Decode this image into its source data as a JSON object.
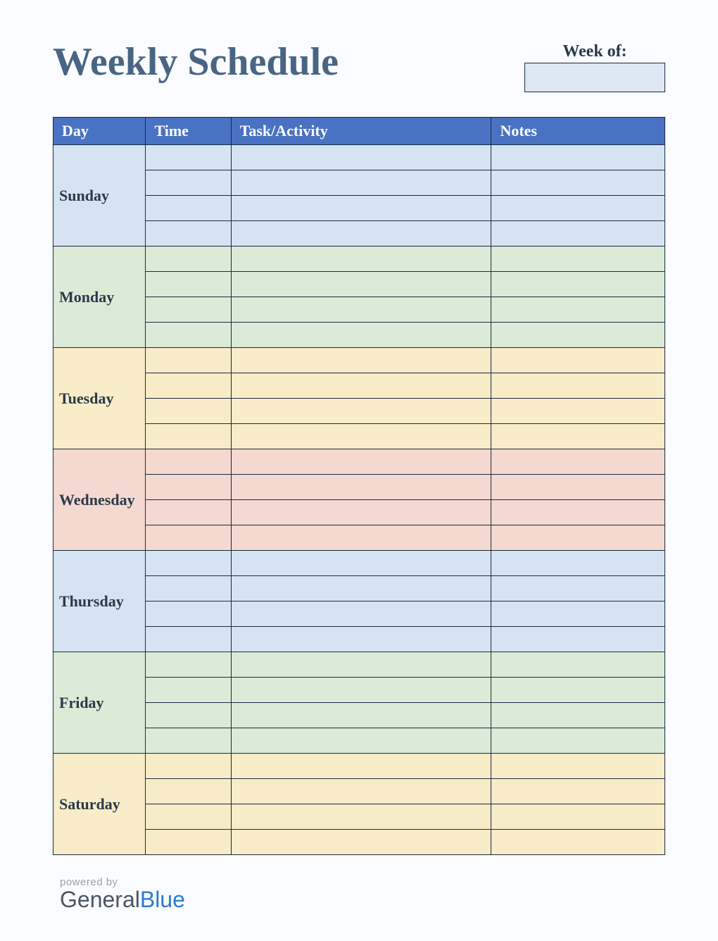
{
  "title": "Weekly Schedule",
  "week_of_label": "Week of:",
  "week_of_value": "",
  "columns": {
    "day": "Day",
    "time": "Time",
    "task": "Task/Activity",
    "notes": "Notes"
  },
  "days": [
    {
      "name": "Sunday",
      "bg": "#d6e3f2",
      "slots": [
        {
          "time": "",
          "task": "",
          "notes": ""
        },
        {
          "time": "",
          "task": "",
          "notes": ""
        },
        {
          "time": "",
          "task": "",
          "notes": ""
        },
        {
          "time": "",
          "task": "",
          "notes": ""
        }
      ]
    },
    {
      "name": "Monday",
      "bg": "#dbebd7",
      "slots": [
        {
          "time": "",
          "task": "",
          "notes": ""
        },
        {
          "time": "",
          "task": "",
          "notes": ""
        },
        {
          "time": "",
          "task": "",
          "notes": ""
        },
        {
          "time": "",
          "task": "",
          "notes": ""
        }
      ]
    },
    {
      "name": "Tuesday",
      "bg": "#f9ecc8",
      "slots": [
        {
          "time": "",
          "task": "",
          "notes": ""
        },
        {
          "time": "",
          "task": "",
          "notes": ""
        },
        {
          "time": "",
          "task": "",
          "notes": ""
        },
        {
          "time": "",
          "task": "",
          "notes": ""
        }
      ]
    },
    {
      "name": "Wednesday",
      "bg": "#f3d9cf",
      "slots": [
        {
          "time": "",
          "task": "",
          "notes": ""
        },
        {
          "time": "",
          "task": "",
          "notes": ""
        },
        {
          "time": "",
          "task": "",
          "notes": ""
        },
        {
          "time": "",
          "task": "",
          "notes": ""
        }
      ]
    },
    {
      "name": "Thursday",
      "bg": "#d6e3f2",
      "slots": [
        {
          "time": "",
          "task": "",
          "notes": ""
        },
        {
          "time": "",
          "task": "",
          "notes": ""
        },
        {
          "time": "",
          "task": "",
          "notes": ""
        },
        {
          "time": "",
          "task": "",
          "notes": ""
        }
      ]
    },
    {
      "name": "Friday",
      "bg": "#dbebd7",
      "slots": [
        {
          "time": "",
          "task": "",
          "notes": ""
        },
        {
          "time": "",
          "task": "",
          "notes": ""
        },
        {
          "time": "",
          "task": "",
          "notes": ""
        },
        {
          "time": "",
          "task": "",
          "notes": ""
        }
      ]
    },
    {
      "name": "Saturday",
      "bg": "#f9ecc8",
      "slots": [
        {
          "time": "",
          "task": "",
          "notes": ""
        },
        {
          "time": "",
          "task": "",
          "notes": ""
        },
        {
          "time": "",
          "task": "",
          "notes": ""
        },
        {
          "time": "",
          "task": "",
          "notes": ""
        }
      ]
    }
  ],
  "footer": {
    "powered_by": "powered by",
    "brand_a": "General",
    "brand_b": "Blue"
  }
}
